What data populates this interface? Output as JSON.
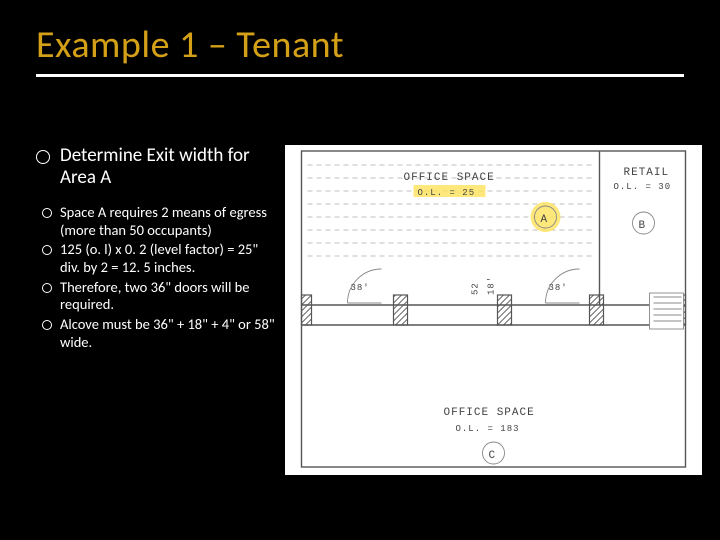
{
  "title": "Example 1 – Tenant",
  "lead_bullet": "Determine Exit width for Area A",
  "sub_bullets": [
    "Space A requires 2 means of egress (more than 50 occupants)",
    "125 (o. l) x 0. 2 (level factor) = 25\"  div. by 2 = 12. 5 inches.",
    "Therefore, two 36\" doors will be required.",
    "Alcove must be 36\" + 18\" + 4\" or 58\" wide."
  ],
  "plan": {
    "top_left_label": "OFFICE SPACE",
    "top_left_ol": "O.L. = 25",
    "top_right_label": "RETAIL",
    "top_right_ol": "O.L. = 30",
    "bottom_label": "OFFICE SPACE",
    "bottom_ol": "O.L. = 183",
    "marker_a": "A",
    "marker_b": "B",
    "marker_c": "C",
    "door_width": "38'",
    "ne_dim_1": "52",
    "ne_dim_2": "18'"
  }
}
